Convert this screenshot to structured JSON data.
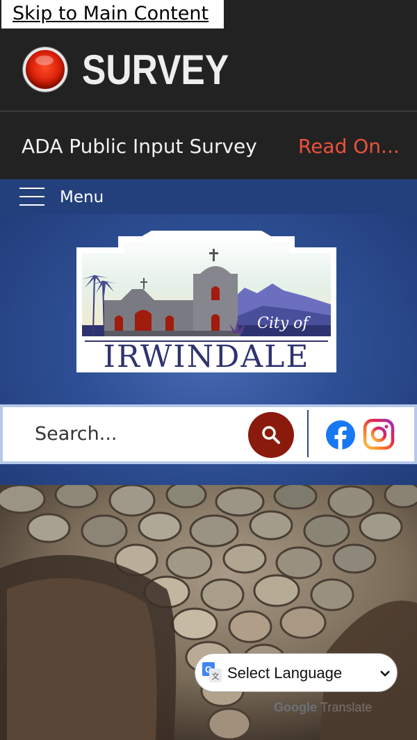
{
  "skip_link": "Skip to Main Content",
  "survey_banner": {
    "title": "SURVEY",
    "dot_color": "#d81e05"
  },
  "ticker": {
    "text": "ADA Public Input Survey",
    "link": "Read On..."
  },
  "nav": {
    "menu_label": "Menu"
  },
  "logo": {
    "city_of": "City of",
    "name": "IRWINDALE"
  },
  "search": {
    "placeholder": "Search..."
  },
  "social": {
    "facebook": "facebook-icon",
    "instagram": "instagram-icon"
  },
  "translate": {
    "select_label": "Select Language",
    "powered_google": "Google",
    "powered_translate": "Translate"
  },
  "colors": {
    "header_blue": "#2e4f95",
    "accent_red": "#f0503a",
    "search_button": "#8a1a0c",
    "dark_bar": "#222222"
  }
}
